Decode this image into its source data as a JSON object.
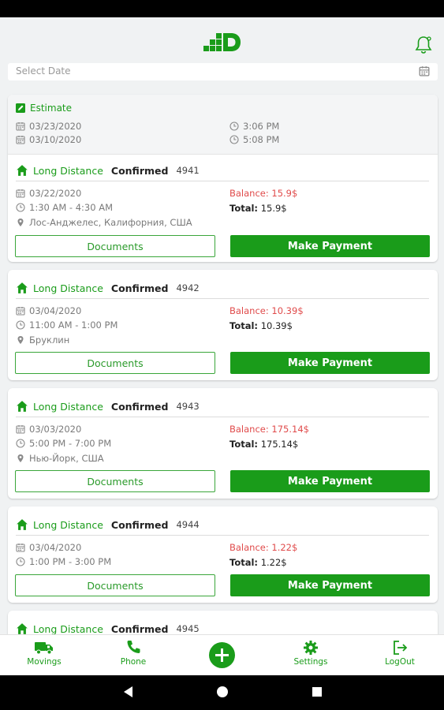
{
  "header": {
    "logo": "D-logo",
    "notification_icon": "bell-icon"
  },
  "date_filter": {
    "placeholder": "Select Date",
    "icon": "calendar-icon"
  },
  "estimate": {
    "title": "Estimate",
    "rows": [
      {
        "date": "03/23/2020",
        "time": "3:06 PM"
      },
      {
        "date": "03/10/2020",
        "time": "5:08 PM"
      }
    ]
  },
  "jobs": [
    {
      "type": "Long Distance",
      "status": "Confirmed",
      "number": "4941",
      "date": "03/22/2020",
      "time": "1:30 AM - 4:30 AM",
      "location": "Лос-Анджелес, Калифорния, США",
      "balance": "Balance: 15.9$",
      "total_label": "Total:",
      "total_value": "15.9$",
      "documents_label": "Documents",
      "payment_label": "Make Payment"
    },
    {
      "type": "Long Distance",
      "status": "Confirmed",
      "number": "4942",
      "date": "03/04/2020",
      "time": "11:00 AM - 1:00 PM",
      "location": "Бруклин",
      "balance": "Balance: 10.39$",
      "total_label": "Total:",
      "total_value": "10.39$",
      "documents_label": "Documents",
      "payment_label": "Make Payment"
    },
    {
      "type": "Long Distance",
      "status": "Confirmed",
      "number": "4943",
      "date": "03/03/2020",
      "time": "5:00 PM - 7:00 PM",
      "location": "Нью-Йорк, США",
      "balance": "Balance: 175.14$",
      "total_label": "Total:",
      "total_value": "175.14$",
      "documents_label": "Documents",
      "payment_label": "Make Payment"
    },
    {
      "type": "Long Distance",
      "status": "Confirmed",
      "number": "4944",
      "date": "03/04/2020",
      "time": "1:00 PM - 3:00 PM",
      "balance": "Balance: 1.22$",
      "total_label": "Total:",
      "total_value": "1.22$",
      "documents_label": "Documents",
      "payment_label": "Make Payment"
    },
    {
      "type": "Long Distance",
      "status": "Confirmed",
      "number": "4945"
    }
  ],
  "bottom_nav": {
    "movings": "Movings",
    "phone": "Phone",
    "settings": "Settings",
    "logout": "LogOut"
  },
  "colors": {
    "accent": "#1a9c1a",
    "balance": "#e04b4b",
    "background": "#f0f2f3"
  }
}
